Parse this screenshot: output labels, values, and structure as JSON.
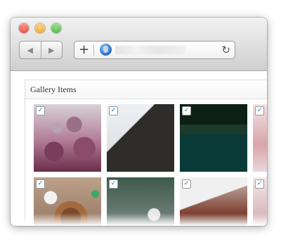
{
  "browser": {
    "url": "",
    "nav": {
      "back_glyph": "◀",
      "forward_glyph": "▶"
    },
    "address_bar": {
      "add_glyph": "+",
      "reload_glyph": "↻",
      "site_icon": "globe-icon"
    }
  },
  "gallery": {
    "title": "Gallery Items",
    "items": [
      {
        "checked": true,
        "status_dot": false
      },
      {
        "checked": true,
        "status_dot": false
      },
      {
        "checked": true,
        "status_dot": false
      },
      {
        "checked": true,
        "status_dot": false
      },
      {
        "checked": true,
        "status_dot": true
      },
      {
        "checked": true,
        "status_dot": false
      },
      {
        "checked": true,
        "status_dot": false
      },
      {
        "checked": true,
        "status_dot": false
      }
    ]
  },
  "colors": {
    "checkmark": "#2a6fb3",
    "status_dot": "#3aa86b"
  }
}
